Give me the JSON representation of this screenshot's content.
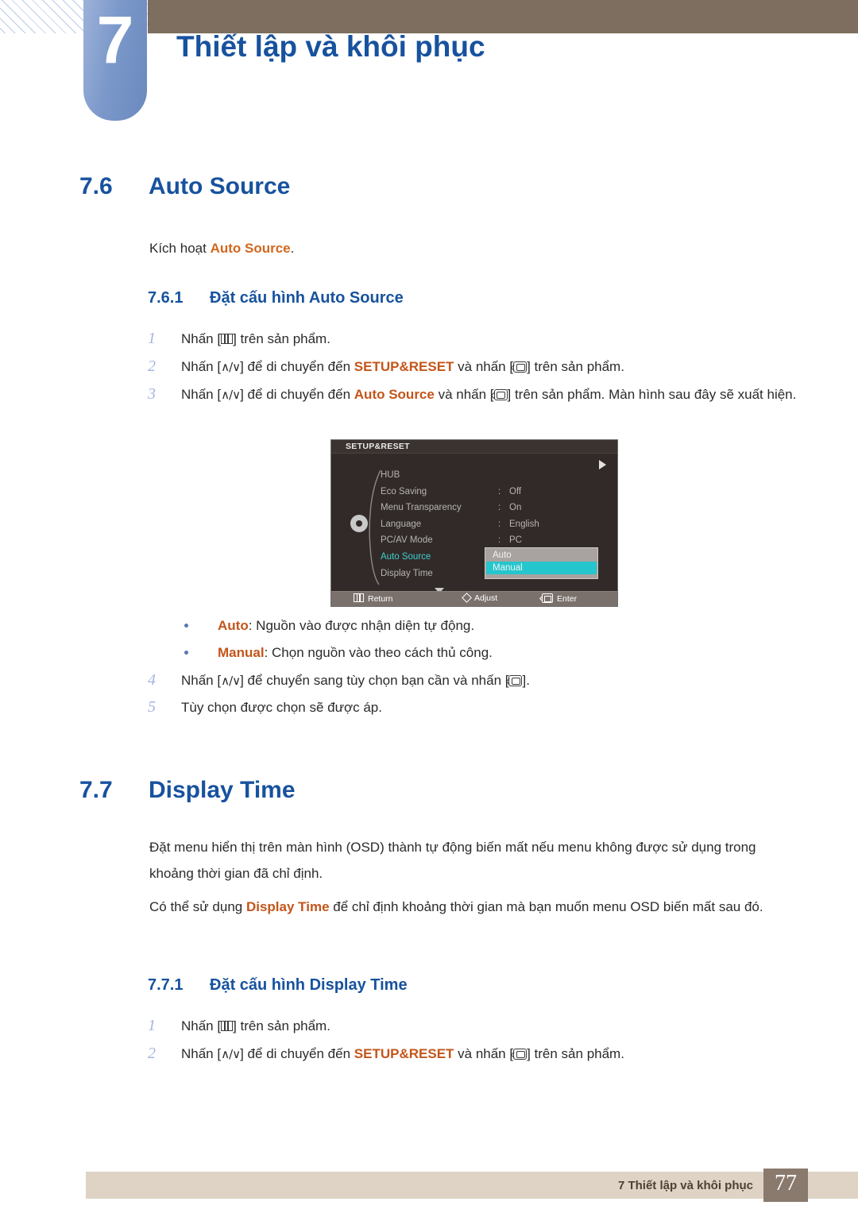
{
  "header": {
    "chapter_number": "7",
    "chapter_title": "Thiết lập và khôi phục"
  },
  "sections": {
    "s76": {
      "number": "7.6",
      "title": "Auto Source",
      "intro_before": "Kích hoạt ",
      "intro_keyword": "Auto Source",
      "intro_after": ".",
      "sub": {
        "number": "7.6.1",
        "title": "Đặt cấu hình Auto Source"
      },
      "steps": [
        {
          "n": "1",
          "parts": [
            "Nhấn [",
            "ICON_MENU",
            "] trên sản phẩm."
          ]
        },
        {
          "n": "2",
          "pre": "Nhấn [",
          "icon1": "ICON_UPDOWN",
          "mid1": "] để di chuyển đến ",
          "kw": "SETUP&RESET",
          "mid2": " và nhấn [",
          "icon2": "ICON_ENTER",
          "post": "] trên sản phẩm."
        },
        {
          "n": "3",
          "pre": "Nhấn [",
          "icon1": "ICON_UPDOWN",
          "mid1": "] để di chuyển đến ",
          "kw": "Auto Source",
          "mid2": " và nhấn [",
          "icon2": "ICON_ENTER",
          "post": "] trên sản phẩm. Màn hình sau đây sẽ xuất hiện."
        },
        {
          "n": "4",
          "pre": "Nhấn [",
          "icon1": "ICON_UPDOWN",
          "mid1": "] để chuyển sang tùy chọn bạn cần và nhấn [",
          "icon2": "ICON_ENTER",
          "post": "]."
        },
        {
          "n": "5",
          "text": "Tùy chọn được chọn sẽ được áp."
        }
      ],
      "bullets": [
        {
          "keyword": "Auto",
          "text": ": Nguồn vào được nhận diện tự động."
        },
        {
          "keyword": "Manual",
          "text": ": Chọn nguồn vào theo cách thủ công."
        }
      ]
    },
    "s77": {
      "number": "7.7",
      "title": "Display Time",
      "para1": "Đặt menu hiển thị trên màn hình (OSD) thành tự động biến mất nếu menu không được sử dụng trong khoảng thời gian đã chỉ định.",
      "para2_pre": "Có thể sử dụng ",
      "para2_kw": "Display Time",
      "para2_post": " để chỉ định khoảng thời gian mà bạn muốn menu OSD biến mất sau đó.",
      "sub": {
        "number": "7.7.1",
        "title": "Đặt cấu hình Display Time"
      },
      "steps": [
        {
          "n": "1",
          "parts": [
            "Nhấn [",
            "ICON_MENU",
            "] trên sản phẩm."
          ]
        },
        {
          "n": "2",
          "pre": "Nhấn [",
          "icon1": "ICON_UPDOWN",
          "mid1": "] để di chuyển đến ",
          "kw": "SETUP&RESET",
          "mid2": " và nhấn [",
          "icon2": "ICON_ENTER",
          "post": "] trên sản phẩm."
        }
      ]
    }
  },
  "osd": {
    "title": "SETUP&RESET",
    "rows": [
      {
        "label": "HUB",
        "colon": "",
        "value": "",
        "selected": false
      },
      {
        "label": "Eco Saving",
        "colon": ":",
        "value": "Off",
        "selected": false
      },
      {
        "label": "Menu Transparency",
        "colon": ":",
        "value": "On",
        "selected": false
      },
      {
        "label": "Language",
        "colon": ":",
        "value": "English",
        "selected": false
      },
      {
        "label": "PC/AV Mode",
        "colon": ":",
        "value": "PC",
        "selected": false
      },
      {
        "label": "Auto Source",
        "colon": ":",
        "value": "",
        "selected": true
      },
      {
        "label": "Display Time",
        "colon": ":",
        "value": "",
        "selected": false
      }
    ],
    "submenu": {
      "options": [
        "Auto",
        "Manual"
      ],
      "highlighted": "Manual",
      "highlight_color": "#25c6cd"
    },
    "footer": {
      "return": "Return",
      "adjust": "Adjust",
      "enter": "Enter"
    }
  },
  "footer": {
    "text": "7 Thiết lập và khôi phục",
    "page": "77"
  },
  "colors": {
    "heading_blue": "#17529e",
    "keyword_orange": "#d2661e",
    "header_brown": "#7d6e5f",
    "chapter_blue": "#7b98ca",
    "footer_beige": "#ded3c4",
    "footer_taupe": "#8a7a6e",
    "osd_cyan": "#3ed0d0"
  }
}
